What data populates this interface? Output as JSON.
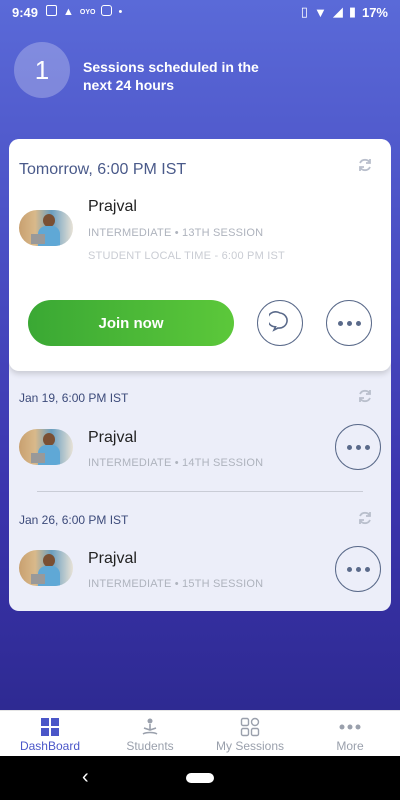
{
  "status_bar": {
    "time": "9:49",
    "battery": "17%",
    "left_icons": [
      "image-icon",
      "alert-icon",
      "oyo-icon",
      "instagram-icon",
      "dot-icon"
    ],
    "oyo_label": "OYO",
    "right_icons": [
      "vibrate-icon",
      "wifi-icon",
      "signal-icon",
      "battery-icon"
    ]
  },
  "header": {
    "count": "1",
    "title": "Sessions scheduled in the next 24 hours"
  },
  "main_session": {
    "time": "Tomorrow, 6:00 PM IST",
    "student_name": "Prajval",
    "details": "INTERMEDIATE • 13TH SESSION",
    "local_time": "STUDENT LOCAL TIME - 6:00 PM IST",
    "join_label": "Join now"
  },
  "upcoming_sessions": [
    {
      "time": "Jan 19, 6:00 PM IST",
      "student_name": "Prajval",
      "details": "INTERMEDIATE • 14TH SESSION"
    },
    {
      "time": "Jan 26, 6:00 PM IST",
      "student_name": "Prajval",
      "details": "INTERMEDIATE • 15TH SESSION"
    }
  ],
  "bottom_nav": {
    "items": [
      {
        "label": "DashBoard",
        "icon": "dashboard-grid-icon",
        "active": true
      },
      {
        "label": "Students",
        "icon": "meditation-icon",
        "active": false
      },
      {
        "label": "My Sessions",
        "icon": "sessions-grid-icon",
        "active": false
      },
      {
        "label": "More",
        "icon": "more-dots-icon",
        "active": false
      }
    ]
  },
  "colors": {
    "accent": "#4a56c8",
    "join_green": "#4cbb37",
    "background_top": "#5a6ad8",
    "background_bottom": "#2e2a92"
  }
}
